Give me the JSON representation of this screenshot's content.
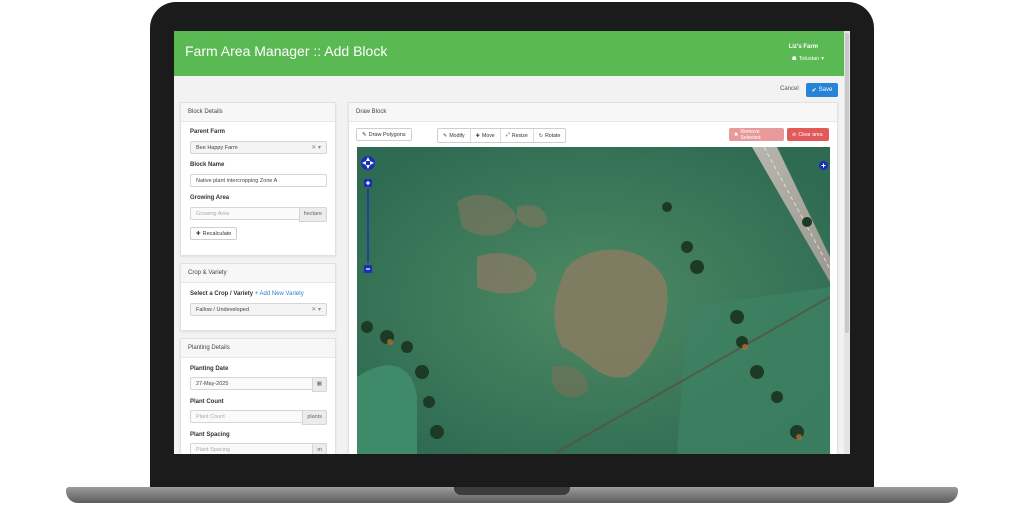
{
  "app": {
    "title": "Farm Area Manager :: Add Block",
    "farm_name": "Liz's Farm",
    "user_name": "Tolustan"
  },
  "actions": {
    "cancel_label": "Cancel",
    "save_label": "Save"
  },
  "block_details": {
    "heading": "Block Details",
    "parent_farm_label": "Parent Farm",
    "parent_farm_value": "Bee Happy Farm",
    "block_name_label": "Block Name",
    "block_name_value": "Native plant intercropping Zone A",
    "growing_area_label": "Growing Area",
    "growing_area_placeholder": "Growing Area",
    "growing_area_unit": "hectare",
    "recalculate_label": "Recalculate"
  },
  "crop_variety": {
    "heading": "Crop & Variety",
    "select_label": "Select a Crop / Variety",
    "add_new_link": "+ Add New Variety",
    "selected_value": "Fallow / Undeveloped"
  },
  "planting": {
    "heading": "Planting Details",
    "date_label": "Planting Date",
    "date_value": "27-May-2025",
    "count_label": "Plant Count",
    "count_placeholder": "Plant Count",
    "count_unit": "plants",
    "spacing_label": "Plant Spacing",
    "spacing_placeholder": "Plant Spacing",
    "spacing_unit": "m"
  },
  "draw_block": {
    "heading": "Draw Block",
    "draw_polygon": "Draw Polygons",
    "modify": "Modify",
    "move": "Move",
    "resize": "Resize",
    "rotate": "Rotate",
    "remove_selected": "Remove Selected",
    "clear_area": "Clear area"
  },
  "colors": {
    "header_green": "#5ab953",
    "save_blue": "#2684d6",
    "remove_pink": "#e89a9a",
    "clear_red": "#e05a5a",
    "map_blue": "#1a2fb8"
  },
  "icons": [
    "caret-down-icon",
    "check-icon",
    "clear-x-icon",
    "refresh-icon",
    "calendar-icon",
    "pencil-icon",
    "move-icon",
    "resize-icon",
    "rotate-icon",
    "trash-icon",
    "ban-icon",
    "compass-icon",
    "zoom-plus-icon",
    "zoom-minus-icon"
  ]
}
